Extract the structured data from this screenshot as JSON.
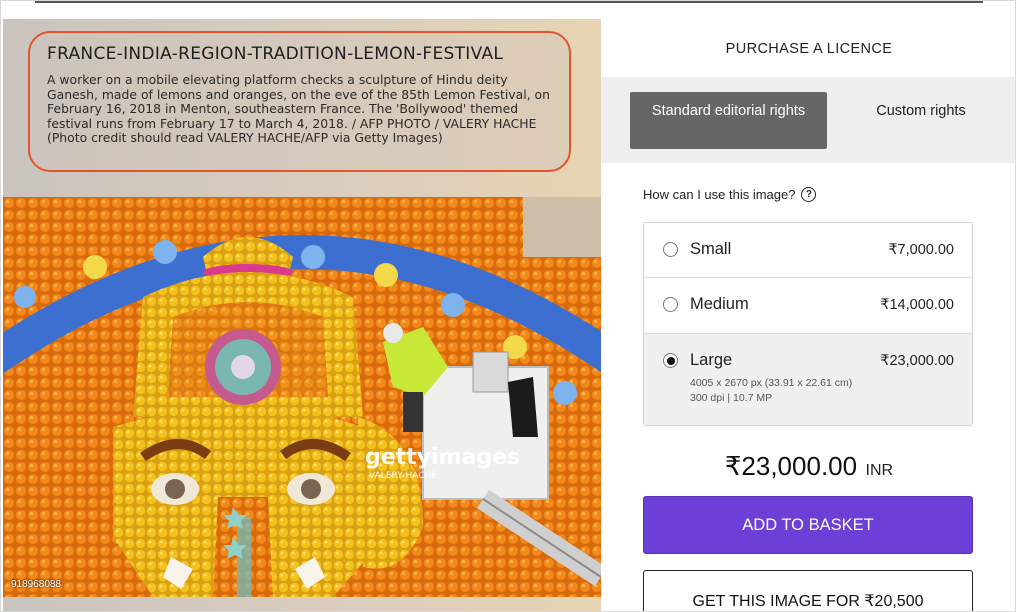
{
  "caption": {
    "title": "FRANCE-INDIA-REGION-TRADITION-LEMON-FESTIVAL",
    "text": "A worker on a mobile elevating platform checks a sculpture of Hindu deity Ganesh, made of lemons and oranges, on the eve of the 85th Lemon Festival, on February 16, 2018 in Menton, southeastern France. The 'Bollywood' themed festival runs from February 17 to March 4, 2018. / AFP PHOTO / VALERY HACHE (Photo credit should read VALERY HACHE/AFP via Getty Images)"
  },
  "photo": {
    "watermark": "gettyimages",
    "watermark_credit": "VALERY HACHE",
    "image_id": "918968088"
  },
  "panel": {
    "title": "PURCHASE A LICENCE",
    "tabs": {
      "standard": "Standard editorial rights",
      "custom": "Custom rights"
    },
    "usage_question": "How can I use this image?",
    "help_symbol": "?"
  },
  "sizes": [
    {
      "name": "Small",
      "price": "₹7,000.00",
      "selected": false
    },
    {
      "name": "Medium",
      "price": "₹14,000.00",
      "selected": false
    },
    {
      "name": "Large",
      "price": "₹23,000.00",
      "selected": true,
      "detail_dims": "4005 x 2670 px (33.91 x 22.61 cm)",
      "detail_res": "300 dpi | 10.7 MP"
    }
  ],
  "total": {
    "amount": "₹23,000.00",
    "currency": "INR"
  },
  "buttons": {
    "add_to_basket": "ADD TO BASKET",
    "get_image": "GET THIS IMAGE FOR ₹20,500"
  },
  "colors": {
    "accent_purple": "#6c3fd6",
    "caption_border": "#e2542e",
    "tab_selected": "#666666"
  }
}
